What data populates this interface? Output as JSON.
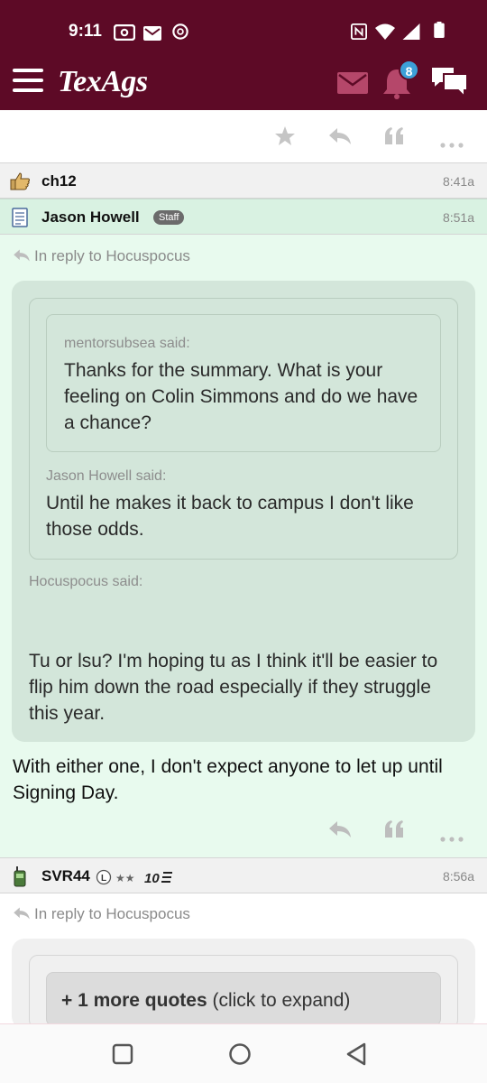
{
  "status_bar": {
    "time": "9:11"
  },
  "app": {
    "logo": "TexAgs",
    "notifications_count": "8"
  },
  "posts": [
    {
      "username": "ch12",
      "time": "8:41a"
    },
    {
      "username": "Jason Howell",
      "badge": "Staff",
      "time": "8:51a",
      "reply_to": "In reply to Hocuspocus",
      "quotes": [
        {
          "who": "mentorsubsea said:",
          "text": "Thanks for the summary. What is your feeling on Colin Simmons and do we have a chance?"
        },
        {
          "who": "Jason Howell said:",
          "text": "Until he makes it back to campus I don't like those odds."
        },
        {
          "who": "Hocuspocus said:",
          "text": "Tu or lsu? I'm hoping tu as I think it'll be easier to flip him down the road especially if they struggle this year."
        }
      ],
      "text": "With either one, I don't expect anyone to let up until Signing Day."
    },
    {
      "username": "SVR44",
      "rank_letter": "L",
      "rank_stars": "★★",
      "rank_number": "10",
      "time": "8:56a",
      "reply_to": "In reply to Hocuspocus",
      "more_quotes_bold": "+ 1 more quotes",
      "more_quotes_rest": " (click to expand)"
    }
  ],
  "colors": {
    "brand": "#5d0a26",
    "highlight_post": "#e8faee",
    "quote_bg": "#d3e6da",
    "badge_blue": "#3ca0d8"
  }
}
